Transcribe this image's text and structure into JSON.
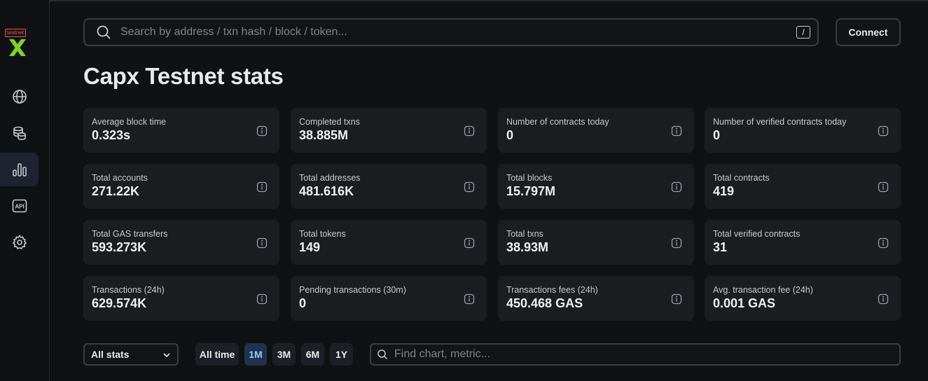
{
  "app": {
    "badge": "testnet",
    "brand_color": "#7ed321"
  },
  "sidebar": {
    "items": [
      {
        "icon": "globe-icon",
        "active": false
      },
      {
        "icon": "coins-icon",
        "active": false
      },
      {
        "icon": "stats-icon",
        "active": true
      },
      {
        "icon": "api-icon",
        "active": false
      },
      {
        "icon": "gear-icon",
        "active": false
      }
    ]
  },
  "header": {
    "search_placeholder": "Search by address / txn hash / block / token...",
    "search_shortcut": "/",
    "connect_label": "Connect"
  },
  "page": {
    "title": "Capx Testnet stats"
  },
  "stats": [
    {
      "label": "Average block time",
      "value": "0.323s"
    },
    {
      "label": "Completed txns",
      "value": "38.885M"
    },
    {
      "label": "Number of contracts today",
      "value": "0"
    },
    {
      "label": "Number of verified contracts today",
      "value": "0"
    },
    {
      "label": "Total accounts",
      "value": "271.22K"
    },
    {
      "label": "Total addresses",
      "value": "481.616K"
    },
    {
      "label": "Total blocks",
      "value": "15.797M"
    },
    {
      "label": "Total contracts",
      "value": "419"
    },
    {
      "label": "Total GAS transfers",
      "value": "593.273K"
    },
    {
      "label": "Total tokens",
      "value": "149"
    },
    {
      "label": "Total txns",
      "value": "38.93M"
    },
    {
      "label": "Total verified contracts",
      "value": "31"
    },
    {
      "label": "Transactions (24h)",
      "value": "629.574K"
    },
    {
      "label": "Pending transactions (30m)",
      "value": "0"
    },
    {
      "label": "Transactions fees (24h)",
      "value": "450.468 GAS"
    },
    {
      "label": "Avg. transaction fee (24h)",
      "value": "0.001 GAS"
    }
  ],
  "filters": {
    "section_select": "All stats",
    "intervals": [
      {
        "label": "All time",
        "active": false
      },
      {
        "label": "1M",
        "active": true
      },
      {
        "label": "3M",
        "active": false
      },
      {
        "label": "6M",
        "active": false
      },
      {
        "label": "1Y",
        "active": false
      }
    ],
    "find_placeholder": "Find chart, metric..."
  }
}
